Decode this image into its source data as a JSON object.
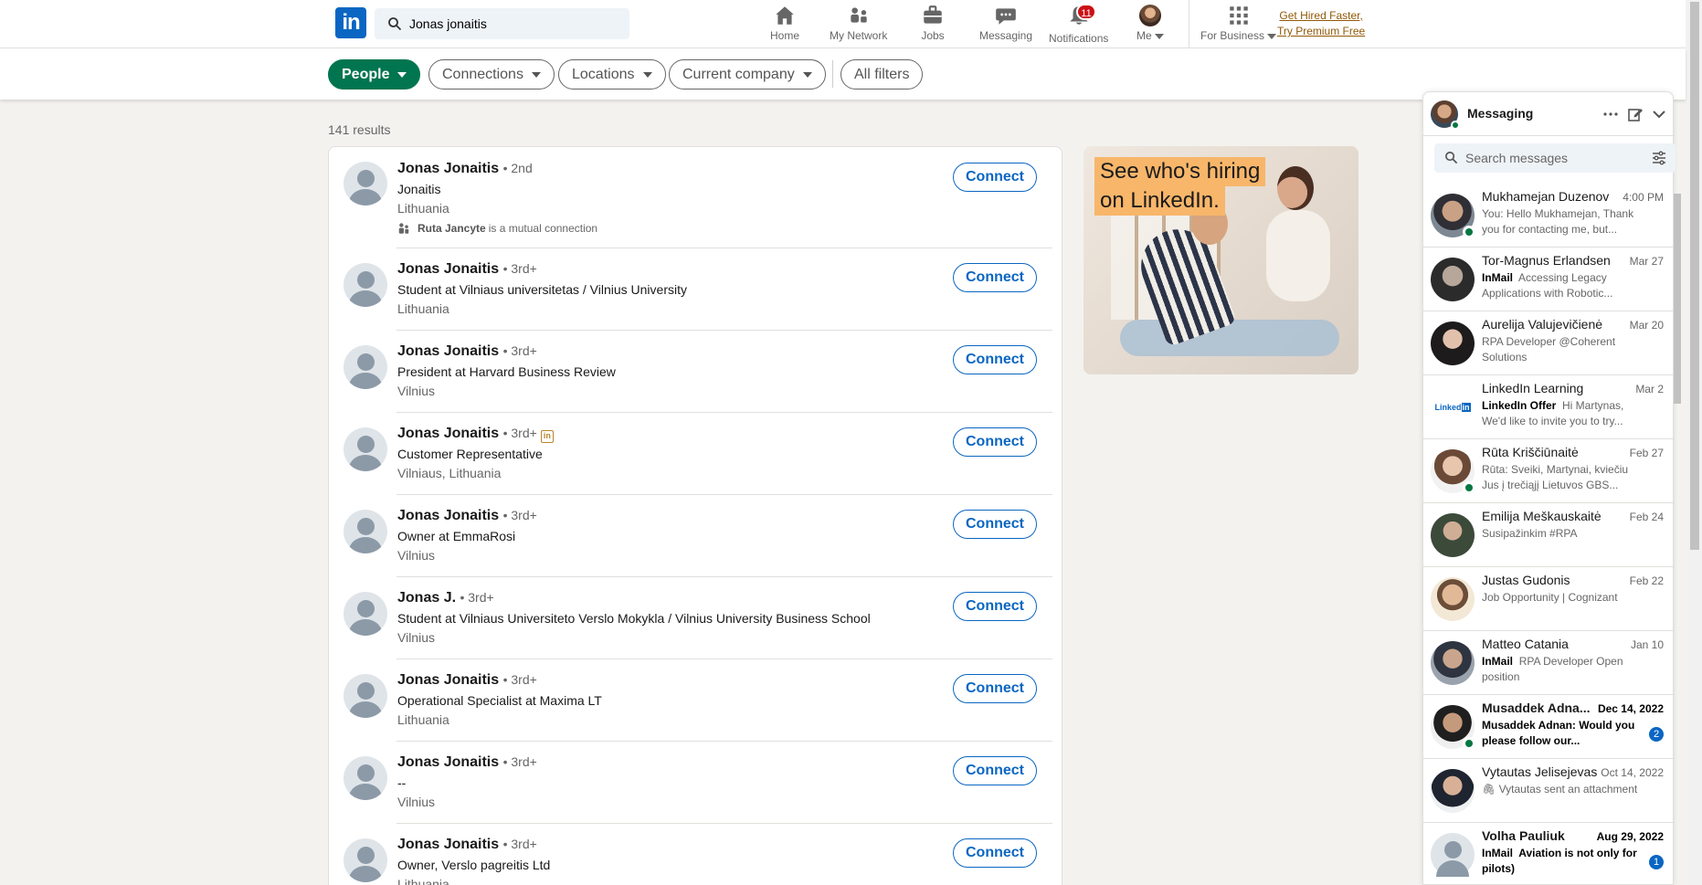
{
  "search": {
    "value": "Jonas jonaitis",
    "placeholder": "Search"
  },
  "nav": {
    "home": "Home",
    "network": "My Network",
    "jobs": "Jobs",
    "messaging": "Messaging",
    "notifications": "Notifications",
    "notifications_count": "11",
    "me": "Me",
    "business": "For Business",
    "premium_line1": "Get Hired Faster,",
    "premium_line2": "Try Premium Free"
  },
  "filters": {
    "people": "People",
    "connections": "Connections",
    "locations": "Locations",
    "company": "Current company",
    "all": "All filters"
  },
  "results_count": "141 results",
  "results": [
    {
      "name": "Jonas Jonaitis",
      "degree": "• 2nd",
      "headline": "Jonaitis",
      "location": "Lithuania",
      "mutual_name": "Ruta Jancyte",
      "mutual_text": "is a mutual connection",
      "action": "Connect"
    },
    {
      "name": "Jonas Jonaitis",
      "degree": "• 3rd+",
      "headline": "Student at Vilniaus universitetas / Vilnius University",
      "location": "Lithuania",
      "action": "Connect"
    },
    {
      "name": "Jonas Jonaitis",
      "degree": "• 3rd+",
      "headline": "President at Harvard Business Review",
      "location": "Vilnius",
      "action": "Connect"
    },
    {
      "name": "Jonas Jonaitis",
      "degree": "• 3rd+",
      "headline": "Customer Representative",
      "location": "Vilniaus, Lithuania",
      "action": "Connect"
    },
    {
      "name": "Jonas Jonaitis",
      "degree": "• 3rd+",
      "headline": "Owner at EmmaRosi",
      "location": "Vilnius",
      "action": "Connect"
    },
    {
      "name": "Jonas J.",
      "degree": "• 3rd+",
      "headline": "Student at Vilniaus Universiteto Verslo Mokykla / Vilnius University Business School",
      "location": "Vilnius",
      "action": "Connect"
    },
    {
      "name": "Jonas Jonaitis",
      "degree": "• 3rd+",
      "headline": "Operational Specialist at Maxima LT",
      "location": "Lithuania",
      "action": "Connect"
    },
    {
      "name": "Jonas Jonaitis",
      "degree": "• 3rd+",
      "headline": "--",
      "location": "Vilnius",
      "action": "Connect"
    },
    {
      "name": "Jonas Jonaitis",
      "degree": "• 3rd+",
      "headline": "Owner, Verslo pagreitis Ltd",
      "location": "Lithuania",
      "action": "Connect"
    }
  ],
  "ad": {
    "line1": "See who's hiring",
    "line2": "on LinkedIn."
  },
  "messaging": {
    "title": "Messaging",
    "search_placeholder": "Search messages",
    "conversations": [
      {
        "name": "Mukhamejan Duzenov",
        "date": "4:00 PM",
        "tag": "",
        "snippet": "You: Hello Mukhamejan, Thank you for contacting me, but...",
        "online": true
      },
      {
        "name": "Tor-Magnus Erlandsen",
        "date": "Mar 27",
        "tag": "InMail",
        "snippet": "Accessing Legacy Applications with Robotic...",
        "online": false
      },
      {
        "name": "Aurelija Valujevičienė",
        "date": "Mar 20",
        "tag": "",
        "snippet": "RPA Developer @Coherent Solutions",
        "online": false
      },
      {
        "name": "LinkedIn Learning",
        "date": "Mar 2",
        "tag": "LinkedIn Offer",
        "snippet": "Hi Martynas, We'd like to invite you to try...",
        "online": false
      },
      {
        "name": "Rūta Kriščiūnaitė",
        "date": "Feb 27",
        "tag": "",
        "snippet": "Rūta: Sveiki, Martynai,  kviečiu Jus į trečiąjį Lietuvos GBS...",
        "online": true
      },
      {
        "name": "Emilija Meškauskaitė",
        "date": "Feb 24",
        "tag": "",
        "snippet": "Susipažinkim #RPA",
        "online": false
      },
      {
        "name": "Justas Gudonis",
        "date": "Feb 22",
        "tag": "",
        "snippet": "Job Opportunity | Cognizant",
        "online": false
      },
      {
        "name": "Matteo Catania",
        "date": "Jan 10",
        "tag": "InMail",
        "snippet": "RPA Developer Open position",
        "online": false
      },
      {
        "name": "Musaddek Adna...",
        "date": "Dec 14, 2022",
        "tag": "",
        "snippet": "Musaddek Adnan: Would you please follow our...",
        "online": true,
        "unread": "2"
      },
      {
        "name": "Vytautas Jelisejevas",
        "date": "Oct 14, 2022",
        "tag": "",
        "snippet": "Vytautas sent an attachment",
        "online": false
      },
      {
        "name": "Volha Pauliuk",
        "date": "Aug 29, 2022",
        "tag": "InMail",
        "snippet": "Aviation is not only for pilots)",
        "online": false,
        "unread": "1"
      }
    ]
  },
  "colors": {
    "brand": "#0a66c2",
    "active_filter": "#01754f",
    "premium": "#915907",
    "badge": "#cc1016",
    "online": "#057642"
  }
}
